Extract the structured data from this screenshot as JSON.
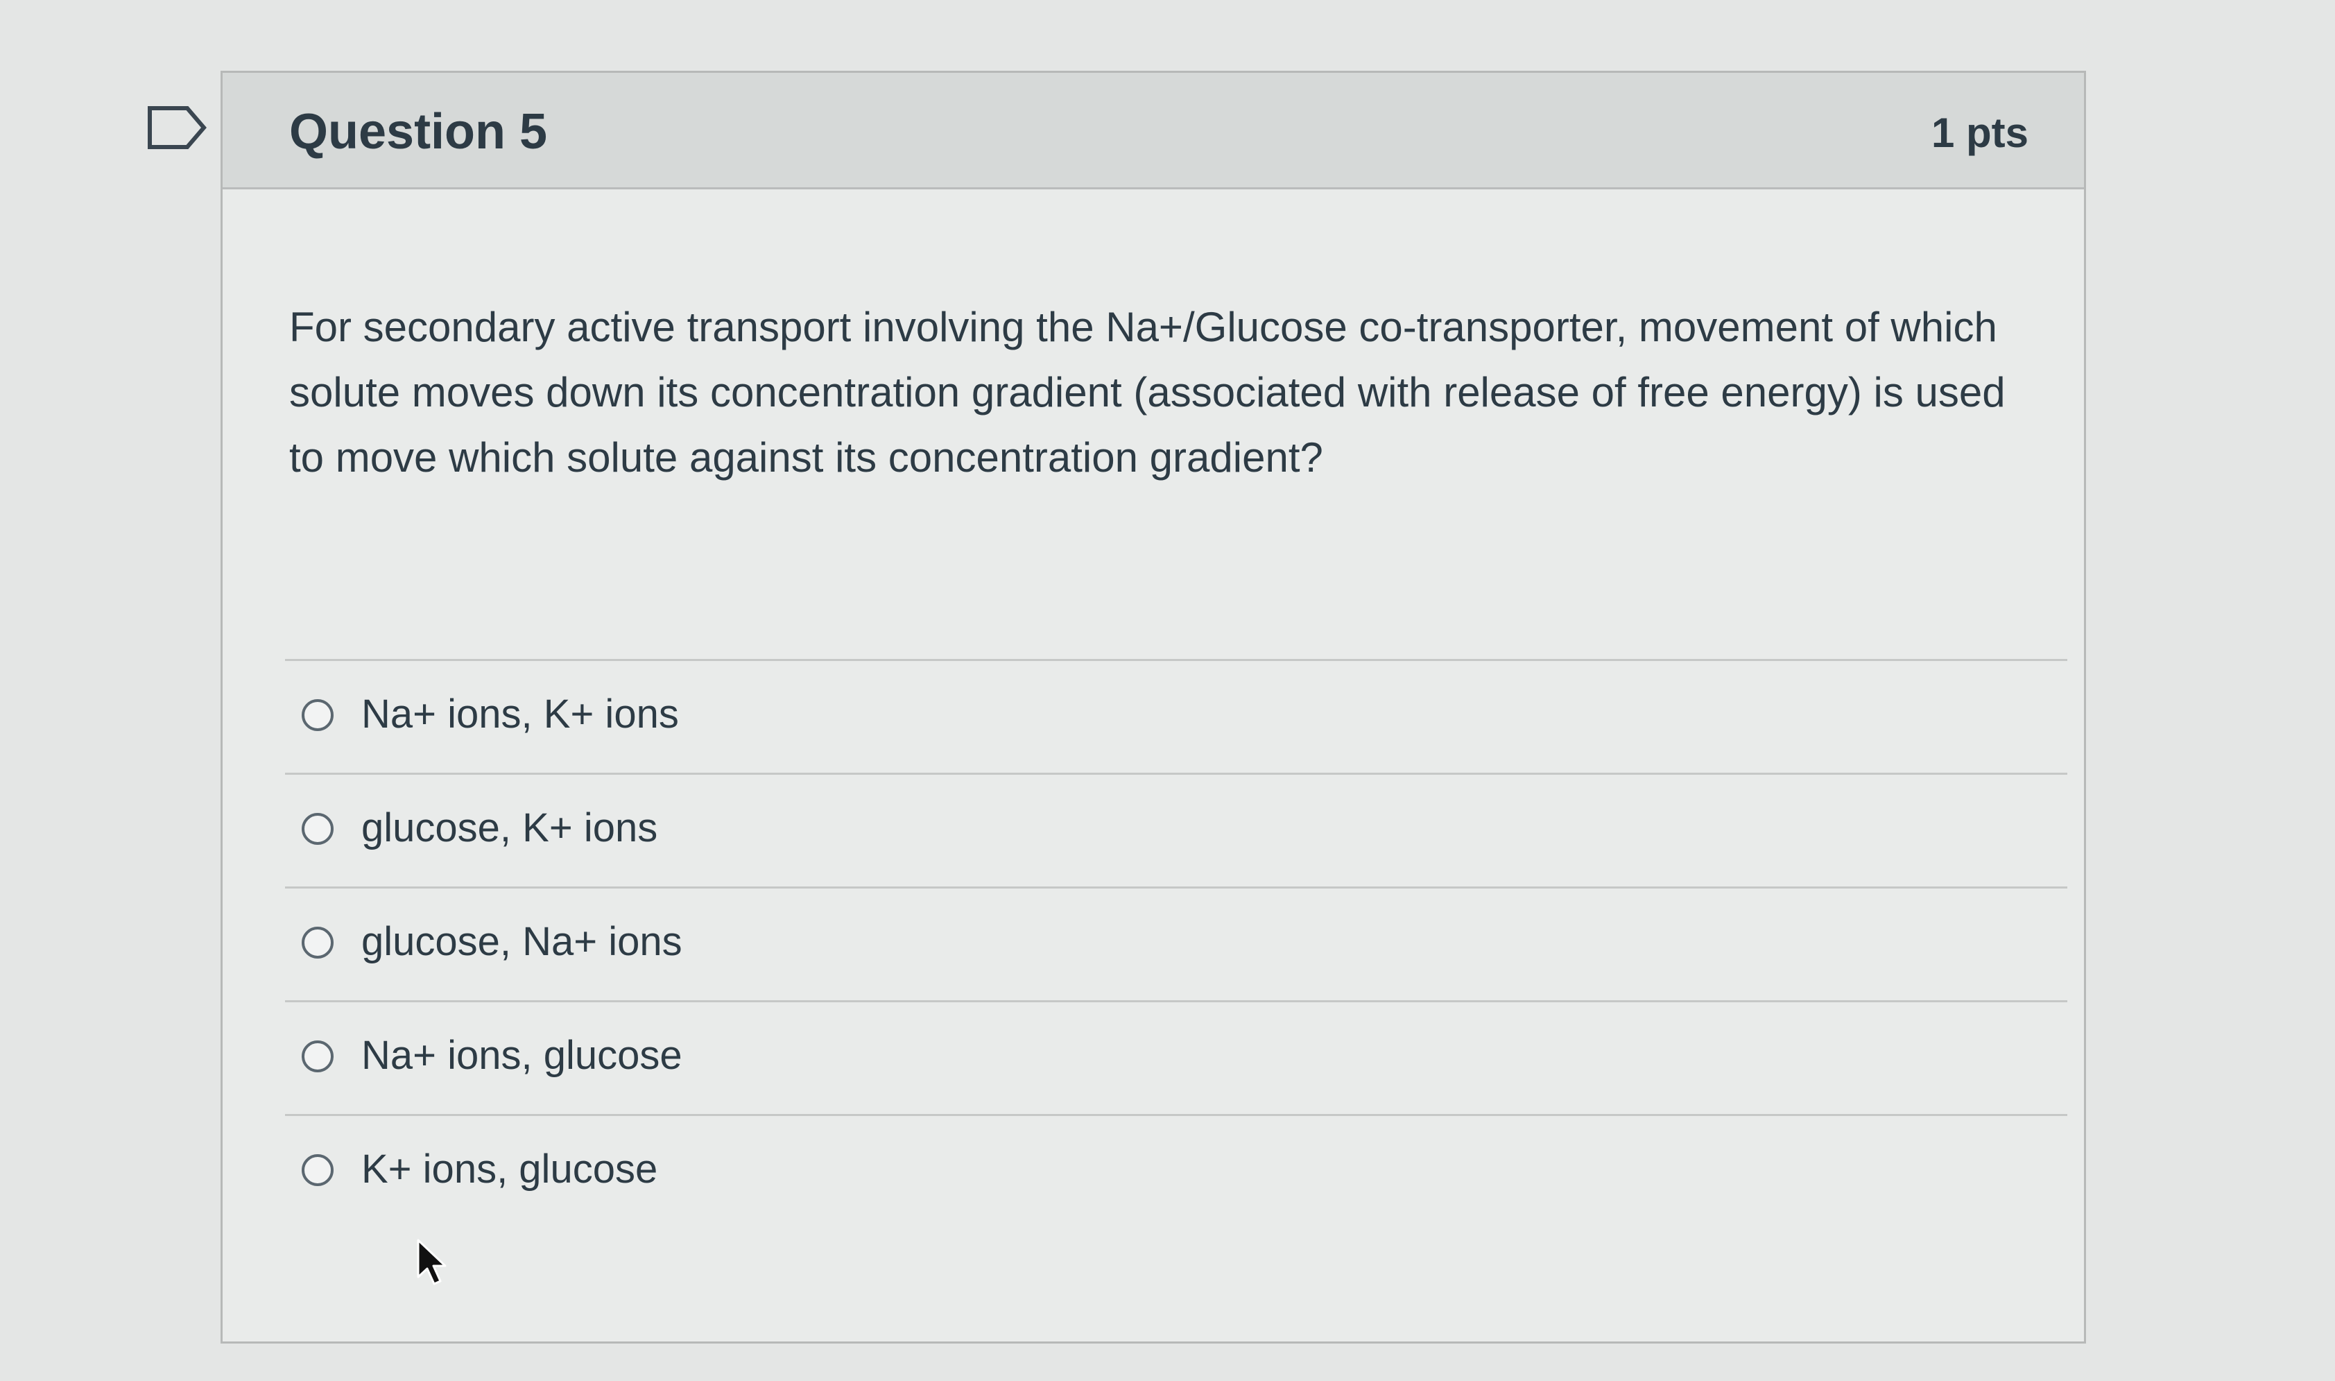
{
  "question": {
    "title": "Question 5",
    "points": "1 pts",
    "text": "For secondary active transport involving the Na+/Glucose co-transporter, movement of which solute moves down its concentration gradient (associated with release of free energy) is used to move which solute against its concentration gradient?"
  },
  "answers": [
    {
      "label": "Na+ ions, K+ ions",
      "selected": false
    },
    {
      "label": "glucose, K+ ions",
      "selected": false
    },
    {
      "label": "glucose, Na+ ions",
      "selected": false
    },
    {
      "label": "Na+ ions, glucose",
      "selected": false
    },
    {
      "label": "K+ ions, glucose",
      "selected": false
    }
  ],
  "icons": {
    "flag": "flag-icon",
    "radio": "radio-unchecked-icon",
    "cursor": "mouse-pointer-icon"
  },
  "colors": {
    "text": "#2d3b45",
    "header_background": "#d6d9d8",
    "card_background": "#e9ebea",
    "border": "#b7b9b8"
  }
}
